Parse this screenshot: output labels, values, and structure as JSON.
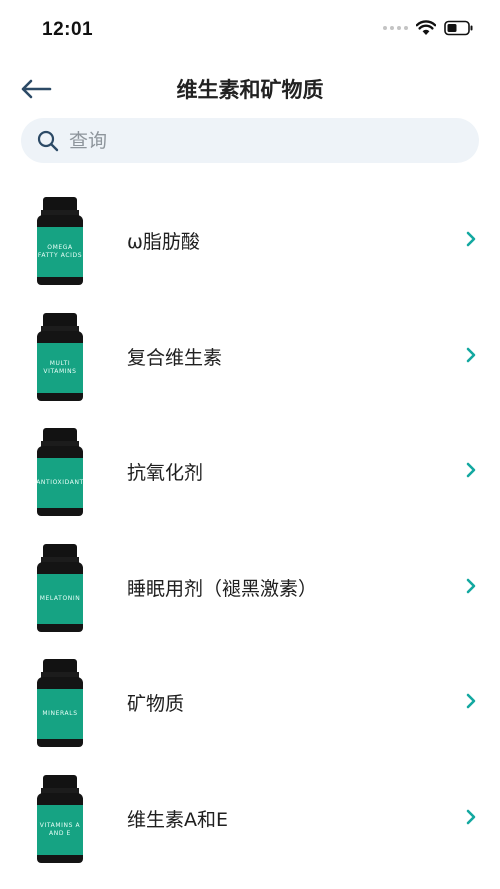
{
  "status_bar": {
    "time": "12:01",
    "icons": [
      "signal-dots-icon",
      "wifi-icon",
      "battery-icon"
    ]
  },
  "header": {
    "title": "维生素和矿物质",
    "back_icon": "arrow-left-icon"
  },
  "search": {
    "placeholder": "查询",
    "value": ""
  },
  "colors": {
    "accent": "#16a383",
    "chevron": "#13a8a0",
    "search_bg": "#eef3f8",
    "back_arrow": "#2c4a66"
  },
  "categories": [
    {
      "label": "ω脂肪酸",
      "bottle_text": [
        "OMEGA",
        "FATTY ACIDS"
      ]
    },
    {
      "label": "复合维生素",
      "bottle_text": [
        "MULTI",
        "VITAMINS"
      ]
    },
    {
      "label": "抗氧化剂",
      "bottle_text": [
        "ANTIOXIDANT"
      ]
    },
    {
      "label": "睡眠用剂（褪黑激素）",
      "bottle_text": [
        "MELATONIN"
      ]
    },
    {
      "label": "矿物质",
      "bottle_text": [
        "MINERALS"
      ]
    },
    {
      "label": "维生素A和E",
      "bottle_text": [
        "VITAMINS A",
        "AND E"
      ]
    }
  ]
}
